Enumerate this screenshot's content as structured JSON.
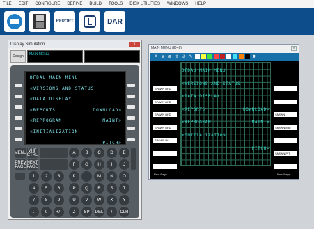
{
  "menu": [
    "FILE",
    "EDIT",
    "CONFIGURE",
    "DEFINE",
    "BUILD",
    "TOOLS",
    "DISK UTILITIES",
    "WINDOWS",
    "HELP"
  ],
  "toolbar": {
    "report": "REPORT",
    "dar": "DAR"
  },
  "sim": {
    "title": "Display Simulation",
    "design": "Design",
    "box1": "MAIN MENU",
    "close": "x"
  },
  "cdu": {
    "lines": [
      {
        "l": "DFDAU MAIN MENU",
        "r": ""
      },
      {
        "l": "",
        "r": ""
      },
      {
        "l": "<VERSIONS AND STATUS",
        "r": ""
      },
      {
        "l": "",
        "r": ""
      },
      {
        "l": "<DATA DISPLAY",
        "r": ""
      },
      {
        "l": "",
        "r": ""
      },
      {
        "l": "<REPORTS",
        "r": "DOWNLOAD>"
      },
      {
        "l": "",
        "r": ""
      },
      {
        "l": "<REPROGRAM",
        "r": "MAINT>"
      },
      {
        "l": "",
        "r": ""
      },
      {
        "l": "<INITIALIZATION",
        "r": ""
      },
      {
        "l": "",
        "r": ""
      },
      {
        "l": "",
        "r": "PITCH>"
      }
    ],
    "keys": {
      "menu": "MENU",
      "vhf": "VHF CTRL",
      "prev": "PREV PAGE",
      "next": "NEXT PAGE",
      "letters": [
        "A",
        "B",
        "C",
        "D",
        "E",
        "F",
        "G",
        "H",
        "I",
        "J",
        "K",
        "L",
        "M",
        "N",
        "O",
        "P",
        "Q",
        "R",
        "S",
        "T",
        "U",
        "V",
        "W",
        "X",
        "Y",
        "Z",
        "SP",
        "DEL",
        "/",
        "CLR"
      ],
      "digits": [
        "1",
        "2",
        "3",
        "4",
        "5",
        "6",
        "7",
        "8",
        "9",
        ".",
        "0",
        "+/-"
      ]
    }
  },
  "editor": {
    "title": "MAIN MENU (ID=8)",
    "close": "x",
    "left": [
      "SPAWN DFD",
      "SPAWN DFD",
      "SPAWN DFD",
      "SPAWN DFD",
      "SPAWN INI",
      "",
      ""
    ],
    "right": [
      "",
      "",
      "SPAWN",
      "SPAWN MAI",
      "",
      "SPAWN PIT",
      ""
    ],
    "lines": [
      {
        "l": "DFDAU MAIN MENU",
        "r": ""
      },
      {
        "l": "<VERSIONS AND STATUS",
        "r": ""
      },
      {
        "l": "<DATA DISPLAY",
        "r": ""
      },
      {
        "l": "<REPORTS",
        "r": "DOWNLOAD>"
      },
      {
        "l": "<REPROGRAM",
        "r": "MAINT>"
      },
      {
        "l": "<INITIALIZATION",
        "r": ""
      },
      {
        "l": "",
        "r": "PITCH>"
      }
    ],
    "next": "Next Page",
    "prev": "Prev Page",
    "colors": [
      "#ffffff",
      "#ffff40",
      "#40e040",
      "#ff4040",
      "#c02020",
      "#ffffff",
      "#40e0ff",
      "#ff8000",
      "#000000"
    ]
  }
}
